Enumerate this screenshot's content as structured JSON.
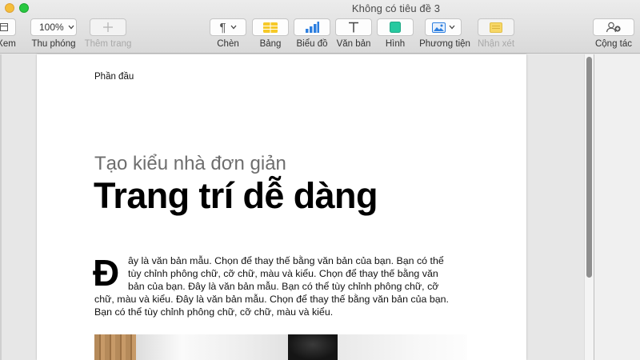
{
  "window": {
    "title": "Không có tiêu đề 3"
  },
  "toolbar": {
    "view_label": "Xem",
    "zoom_value": "100%",
    "zoom_label": "Thu phóng",
    "add_page_label": "Thêm trang",
    "insert_label": "Chèn",
    "table_label": "Bảng",
    "chart_label": "Biểu đồ",
    "text_label": "Văn bản",
    "shape_label": "Hình",
    "media_label": "Phương tiện",
    "comment_label": "Nhận xét",
    "collaborate_label": "Cộng tác"
  },
  "document": {
    "header": "Phần đầu",
    "subtitle": "Tạo kiểu nhà đơn giản",
    "title": "Trang trí dễ dàng",
    "drop_cap": "Đ",
    "body_lines": [
      "ây là văn bản mẫu. Chọn để thay thế bằng văn bản của bạn. Bạn có thể",
      "tùy chỉnh phông chữ, cỡ chữ, màu và kiểu. Chọn để thay thế bằng văn",
      "bản của bạn. Đây là văn bản mẫu. Bạn có thể tùy chỉnh phông chữ, cỡ",
      "chữ, màu và kiểu. Đây là văn bản mẫu. Chọn để thay thế bằng văn bản của bạn.",
      "Bạn có thể tùy chỉnh phông chữ, cỡ chữ, màu và kiểu."
    ]
  },
  "colors": {
    "toolbar_bg": "#e3e3e3",
    "table_icon": "#f6c928",
    "chart_icon": "#2d7fe0",
    "shape_icon": "#27c9a0",
    "comment_icon": "#f7d766",
    "traffic_yellow": "#f5be3a",
    "traffic_green": "#28c840"
  },
  "icons": {
    "view": "sidebar-view-icon",
    "add_page": "plus-icon",
    "insert": "paragraph-icon",
    "table": "table-icon",
    "chart": "bar-chart-icon",
    "text": "text-t-icon",
    "shape": "square-shape-icon",
    "media": "photo-icon",
    "comment": "note-icon",
    "collaborate": "add-person-icon"
  }
}
